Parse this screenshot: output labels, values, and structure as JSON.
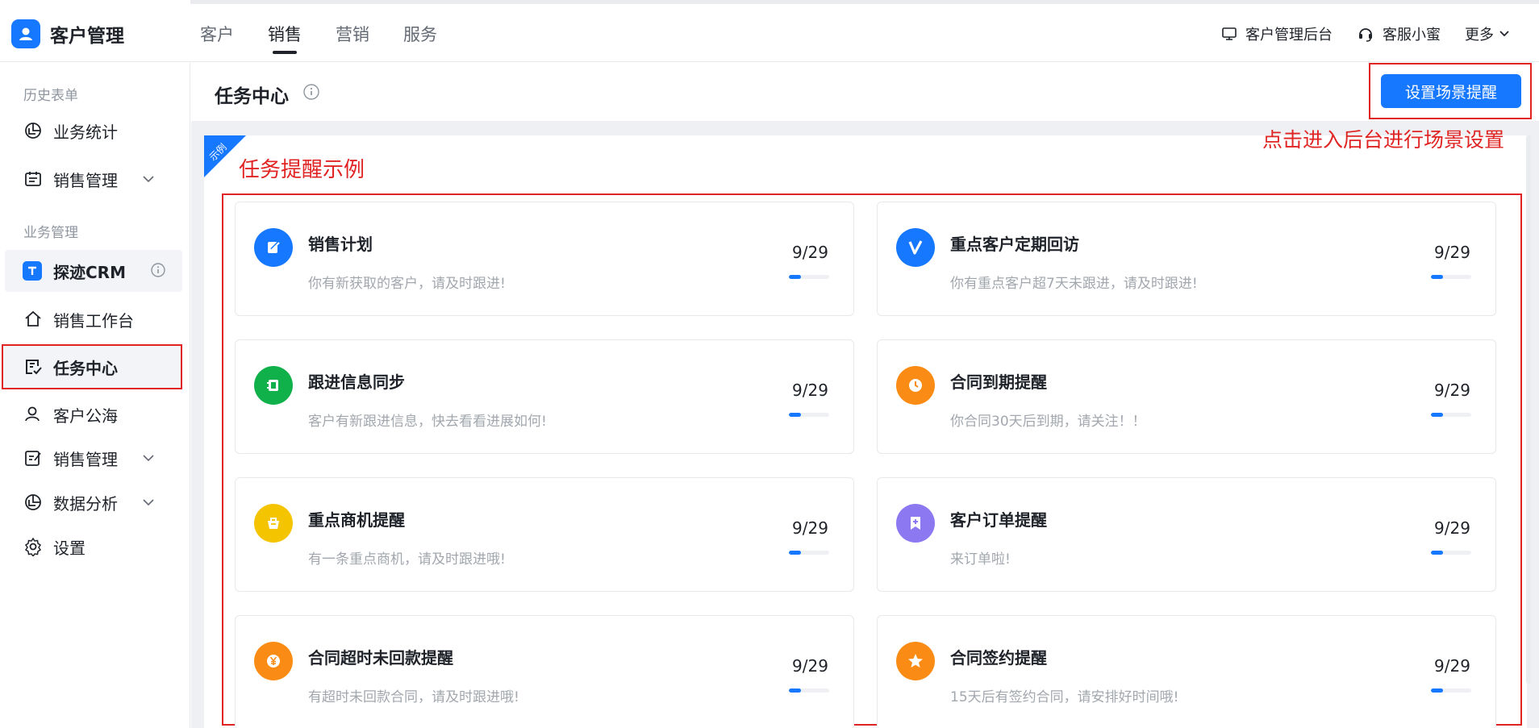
{
  "app": {
    "title": "客户管理"
  },
  "nav": {
    "tabs": [
      "客户",
      "销售",
      "营销",
      "服务"
    ],
    "active": "销售"
  },
  "header_right": {
    "admin": "客户管理后台",
    "support": "客服小蜜",
    "more": "更多"
  },
  "sidebar": {
    "section_history": "历史表单",
    "stats": "业务统计",
    "sales_mgmt_1": "销售管理",
    "section_business": "业务管理",
    "crm": "探迹CRM",
    "workbench": "销售工作台",
    "task_center": "任务中心",
    "customer_pool": "客户公海",
    "sales_mgmt_2": "销售管理",
    "data_analysis": "数据分析",
    "settings": "设置"
  },
  "page": {
    "title": "任务中心",
    "setup_button": "设置场景提醒",
    "setup_note": "点击进入后台进行场景设置",
    "ribbon": "示例",
    "example_title": "任务提醒示例"
  },
  "cards": [
    {
      "title": "销售计划",
      "desc": "你有新获取的客户，请及时跟进!",
      "count": "9/29",
      "progress": 0.3,
      "color": "#1677ff",
      "icon": "edit-icon"
    },
    {
      "title": "重点客户定期回访",
      "desc": "你有重点客户超7天未跟进，请及时跟进!",
      "count": "9/29",
      "progress": 0.3,
      "color": "#1677ff",
      "icon": "v-icon"
    },
    {
      "title": "跟进信息同步",
      "desc": "客户有新跟进信息，快去看看进展如何!",
      "count": "9/29",
      "progress": 0.3,
      "color": "#10b14b",
      "icon": "notebook-icon"
    },
    {
      "title": "合同到期提醒",
      "desc": "你合同30天后到期，请关注！！",
      "count": "9/29",
      "progress": 0.3,
      "color": "#fa8c16",
      "icon": "clock-icon"
    },
    {
      "title": "重点商机提醒",
      "desc": "有一条重点商机，请及时跟进哦!",
      "count": "9/29",
      "progress": 0.3,
      "color": "#f5c400",
      "icon": "bag-icon"
    },
    {
      "title": "客户订单提醒",
      "desc": "来订单啦!",
      "count": "9/29",
      "progress": 0.3,
      "color": "#8c79f2",
      "icon": "bookmark-icon"
    },
    {
      "title": "合同超时未回款提醒",
      "desc": "有超时未回款合同，请及时跟进哦!",
      "count": "9/29",
      "progress": 0.3,
      "color": "#fa8c16",
      "icon": "yen-icon"
    },
    {
      "title": "合同签约提醒",
      "desc": "15天后有签约合同，请安排好时间哦!",
      "count": "9/29",
      "progress": 0.3,
      "color": "#fa8c16",
      "icon": "star-icon"
    }
  ]
}
